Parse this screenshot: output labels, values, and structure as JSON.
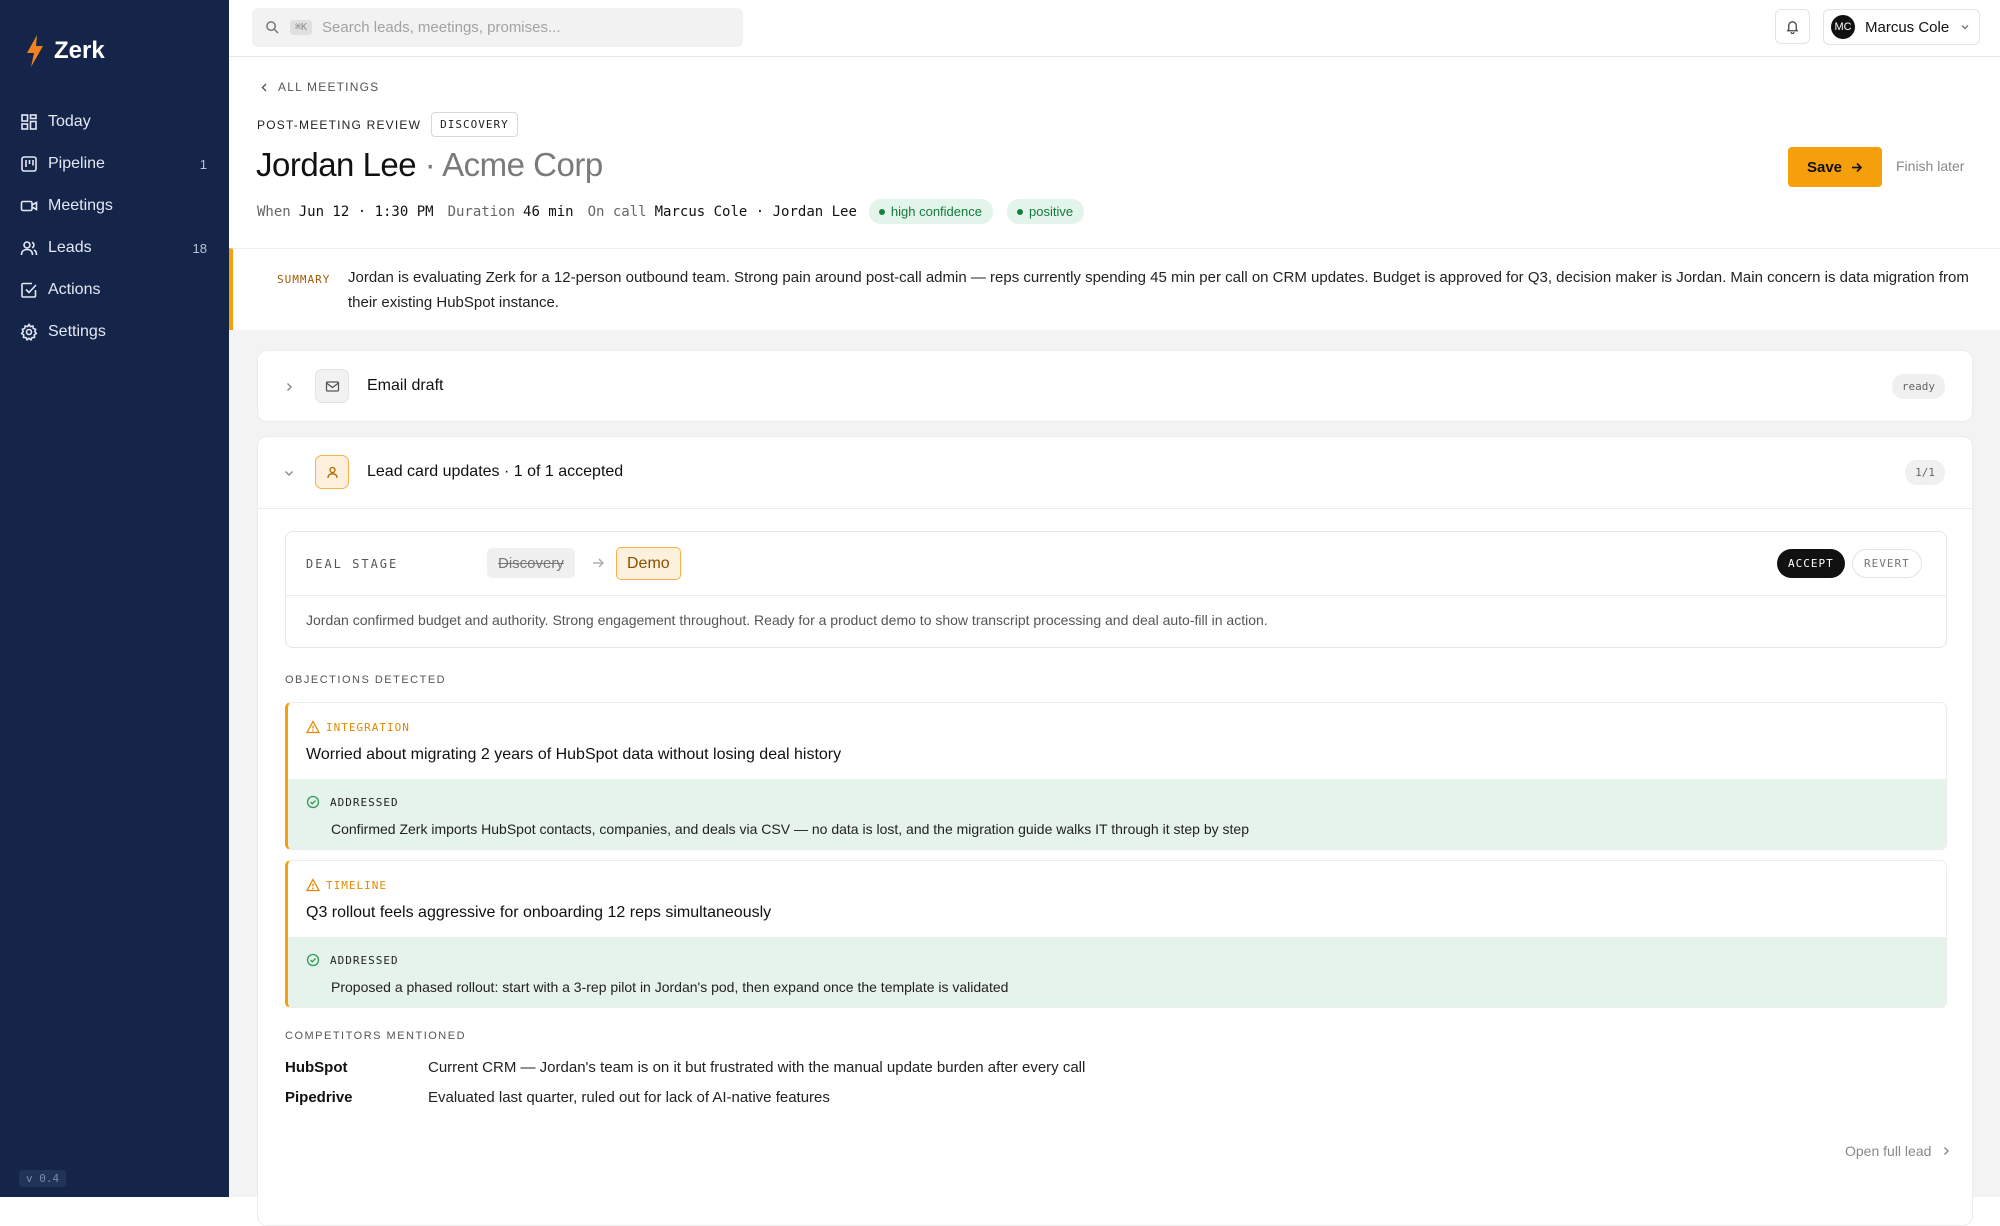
{
  "app": {
    "name": "Zerk",
    "version": "v 0.4"
  },
  "sidebar": {
    "items": [
      {
        "label": "Today",
        "icon": "grid-icon",
        "count": ""
      },
      {
        "label": "Pipeline",
        "icon": "kanban-icon",
        "count": "1"
      },
      {
        "label": "Meetings",
        "icon": "video-icon",
        "count": ""
      },
      {
        "label": "Leads",
        "icon": "users-icon",
        "count": "18"
      },
      {
        "label": "Actions",
        "icon": "check-square-icon",
        "count": ""
      },
      {
        "label": "Settings",
        "icon": "gear-icon",
        "count": ""
      }
    ]
  },
  "topbar": {
    "search_kbd": "⌘K",
    "search_placeholder": "Search leads, meetings, promises...",
    "user_initials": "MC",
    "user_name": "Marcus Cole"
  },
  "header": {
    "back_label": "ALL MEETINGS",
    "kicker": "POST-MEETING REVIEW",
    "stage_tag": "DISCOVERY",
    "lead_name": "Jordan Lee",
    "separator": " · ",
    "company": "Acme Corp",
    "meta": {
      "when_label": "When",
      "when_value": "Jun 12 · 1:30 PM",
      "duration_label": "Duration",
      "duration_value": "46 min",
      "oncall_label": "On call",
      "oncall_value": "Marcus Cole · Jordan Lee"
    },
    "pills": [
      "high confidence",
      "positive"
    ],
    "save_label": "Save",
    "finish_label": "Finish later"
  },
  "summary": {
    "label": "SUMMARY",
    "text": "Jordan is evaluating Zerk for a 12-person outbound team. Strong pain around post-call admin — reps currently spending 45 min per call on CRM updates. Budget is approved for Q3, decision maker is Jordan. Main concern is data migration from their existing HubSpot instance."
  },
  "email_draft": {
    "title": "Email draft",
    "badge": "ready"
  },
  "lead_updates": {
    "title": "Lead card updates · 1 of 1 accepted",
    "badge": "1/1",
    "deal_stage": {
      "label": "DEAL STAGE",
      "from": "Discovery",
      "to": "Demo",
      "accept_label": "ACCEPT",
      "revert_label": "REVERT",
      "note": "Jordan confirmed budget and authority. Strong engagement throughout. Ready for a product demo to show transcript processing and deal auto-fill in action."
    },
    "objections_label": "OBJECTIONS DETECTED",
    "objections": [
      {
        "category": "INTEGRATION",
        "question": "Worried about migrating 2 years of HubSpot data without losing deal history",
        "status": "ADDRESSED",
        "answer": "Confirmed Zerk imports HubSpot contacts, companies, and deals via CSV — no data is lost, and the migration guide walks IT through it step by step"
      },
      {
        "category": "TIMELINE",
        "question": "Q3 rollout feels aggressive for onboarding 12 reps simultaneously",
        "status": "ADDRESSED",
        "answer": "Proposed a phased rollout: start with a 3-rep pilot in Jordan's pod, then expand once the template is validated"
      }
    ],
    "competitors_label": "COMPETITORS MENTIONED",
    "competitors": [
      {
        "name": "HubSpot",
        "note": "Current CRM — Jordan's team is on it but frustrated with the manual update burden after every call"
      },
      {
        "name": "Pipedrive",
        "note": "Evaluated last quarter, ruled out for lack of AI-native features"
      }
    ],
    "open_full_lead": "Open full lead"
  },
  "colors": {
    "sidebar_bg": "#15254a",
    "accent": "#f59f0a",
    "success_bg": "#e6f3ea"
  }
}
